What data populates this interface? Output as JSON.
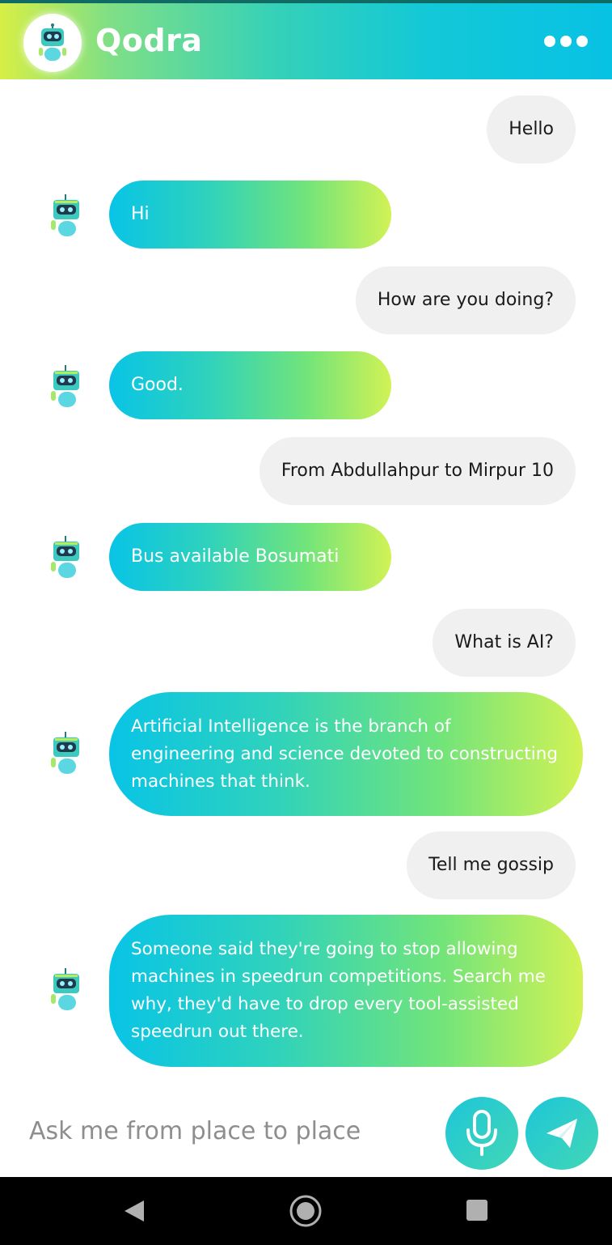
{
  "app": {
    "title": "Qodra",
    "logo_icon": "robot-icon",
    "menu_icon": "more-dots-icon"
  },
  "messages": [
    {
      "sender": "user",
      "text": "Hello"
    },
    {
      "sender": "bot",
      "text": "Hi"
    },
    {
      "sender": "user",
      "text": "How are you doing?"
    },
    {
      "sender": "bot",
      "text": "Good."
    },
    {
      "sender": "user",
      "text": "From Abdullahpur to Mirpur 10"
    },
    {
      "sender": "bot",
      "text": "Bus available Bosumati"
    },
    {
      "sender": "user",
      "text": "What is AI?"
    },
    {
      "sender": "bot",
      "lines": [
        "Artificial Intelligence is the branch of",
        "engineering and science devoted to constructing",
        "machines that think."
      ]
    },
    {
      "sender": "user",
      "text": "Tell me gossip"
    },
    {
      "sender": "bot",
      "lines": [
        "Someone said they're going to stop allowing",
        "machines in speedrun competitions. Search me",
        "why, they'd have to drop every tool-assisted",
        "speedrun out there."
      ]
    }
  ],
  "composer": {
    "placeholder": "Ask me from place to place",
    "mic_icon": "microphone-icon",
    "send_icon": "send-icon"
  },
  "navbar": {
    "back_icon": "back-triangle-icon",
    "home_icon": "home-circle-icon",
    "recent_icon": "recent-apps-icon"
  },
  "colors": {
    "header_gradient": [
      "#d7ef45",
      "#08c2e4"
    ],
    "bot_bubble_gradient": [
      "#08c4e6",
      "#d2f255"
    ],
    "user_bubble": "#f0f0f0"
  }
}
